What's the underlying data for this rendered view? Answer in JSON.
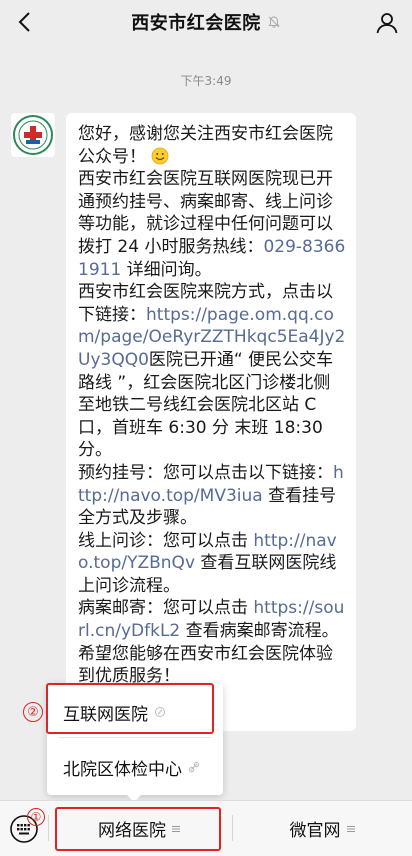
{
  "header": {
    "title": "西安市红会医院",
    "back_icon": "chevron-left-icon",
    "mute_icon": "bell-off-icon",
    "profile_icon": "person-icon"
  },
  "timestamp": "下午3:49",
  "message": {
    "p1": "您好，感谢您关注西安市红会医院公众号！",
    "p2": "西安市红会医院互联网医院现已开通预约挂号、病案邮寄、线上问诊等功能，就诊过程中任何问题可以拨打 24 小时服务热线：",
    "hotline": "029-83661911",
    "hotline_after": " 详细问询。",
    "p3": "西安市红会医院来院方式，点击以下链接：",
    "p3_link": "https://page.om.qq.com/page/OeRyrZZTHkqc5Ea4Jy2Uy3QQ0",
    "p3_after": "医院已开通“ 便民公交车路线 ”，红会医院北区门诊楼北侧至地铁二号线红会医院北区站 C 口，首班车 6:30 分 末班 18:30 分。",
    "p4": "预约挂号：您可以点击以下链接：",
    "p4_link": "http://navo.top/MV3iua",
    "p4_after": " 查看挂号全方式及步骤。",
    "p5": "线上问诊：您可以点击 ",
    "p5_link": "http://navo.top/YZBnQv",
    "p5_after": " 查看互联网医院线上问诊流程。",
    "p6": "病案邮寄：您可以点击 ",
    "p6_link": "https://sourl.cn/yDfkL2",
    "p6_after": " 查看病案邮寄流程。",
    "p7": "希望您能够在西安市红会医院体验到优质服务！"
  },
  "popup_menu": {
    "items": [
      {
        "label": "互联网医院"
      },
      {
        "label": "北院区体检中心"
      }
    ]
  },
  "annotations": {
    "step1": "①",
    "step2": "②",
    "highlight_color": "#e02424"
  },
  "bottom_menu": {
    "keyboard_icon": "keyboard-icon",
    "tab1": "网络医院",
    "tab2": "微官网"
  }
}
